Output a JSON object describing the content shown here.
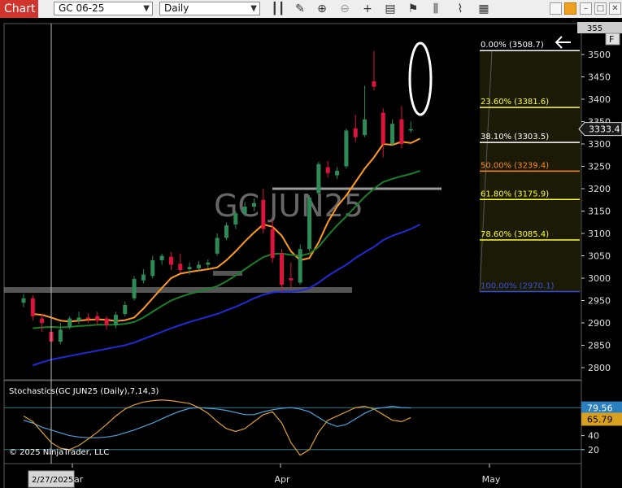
{
  "toolbar": {
    "tab_label": "Chart",
    "instrument": "GC 06-25",
    "interval": "Daily",
    "icons": [
      "bar-type-icon",
      "draw-pencil-icon",
      "zoom-in-icon",
      "zoom-out-icon",
      "crosshair-icon",
      "data-box-icon",
      "strategies-icon",
      "indicators-icon",
      "templates-icon",
      "properties-icon"
    ]
  },
  "chart": {
    "watermark": "GC JUN25",
    "copyright": "© 2025 NinjaTrader, LLC",
    "stoch_label": "Stochastics(GC JUN25 (Daily),7,14,3)",
    "current_price": "3333.4",
    "top_price": "355",
    "f_label": "F",
    "cursor_date": "2/27/2025",
    "x_labels": [
      {
        "text": "ar",
        "x": 91
      },
      {
        "text": "Apr",
        "x": 347
      },
      {
        "text": "May",
        "x": 604
      }
    ],
    "price_ticks": [
      2800,
      2850,
      2900,
      2950,
      3000,
      3050,
      3100,
      3150,
      3200,
      3250,
      3300,
      3350,
      3400,
      3450,
      3500
    ],
    "stoch_ticks": [
      20,
      40
    ],
    "stoch_values": {
      "k": "79.56",
      "d": "65.79"
    },
    "fib_levels": [
      {
        "label": "0.00% (3508.7)",
        "price": 3508.7,
        "color": "#ffffff"
      },
      {
        "label": "23.60% (3381.6)",
        "price": 3381.6,
        "color": "#ffff33"
      },
      {
        "label": "38.10% (3303.5)",
        "price": 3303.5,
        "color": "#ffffff"
      },
      {
        "label": "50.00% (3239.4)",
        "price": 3239.4,
        "color": "#ff8c1a"
      },
      {
        "label": "61.80% (3175.9)",
        "price": 3175.9,
        "color": "#ffff33"
      },
      {
        "label": "78.60% (3085.4)",
        "price": 3085.4,
        "color": "#ffff33"
      },
      {
        "label": "100.00% (2970.1)",
        "price": 2970.1,
        "color": "#3a4fd6"
      }
    ],
    "colors": {
      "up": "#2e8b57",
      "down": "#dc143c",
      "ema_fast": "#ff9a1f",
      "ema_mid": "#1a7f2a",
      "ema_slow": "#1f2bd6",
      "stoch_k": "#4aa3df",
      "stoch_d": "#e0a030"
    }
  },
  "chart_data": {
    "type": "candlestick",
    "title": "",
    "candles": [
      {
        "o": 2945,
        "h": 2965,
        "l": 2935,
        "c": 2955
      },
      {
        "o": 2955,
        "h": 2962,
        "l": 2905,
        "c": 2915
      },
      {
        "o": 2910,
        "h": 2920,
        "l": 2880,
        "c": 2900
      },
      {
        "o": 2880,
        "h": 2890,
        "l": 2848,
        "c": 2858
      },
      {
        "o": 2858,
        "h": 2900,
        "l": 2852,
        "c": 2885
      },
      {
        "o": 2892,
        "h": 2915,
        "l": 2886,
        "c": 2910
      },
      {
        "o": 2905,
        "h": 2925,
        "l": 2898,
        "c": 2912
      },
      {
        "o": 2912,
        "h": 2922,
        "l": 2900,
        "c": 2908
      },
      {
        "o": 2915,
        "h": 2925,
        "l": 2895,
        "c": 2905
      },
      {
        "o": 2910,
        "h": 2915,
        "l": 2885,
        "c": 2895
      },
      {
        "o": 2895,
        "h": 2925,
        "l": 2888,
        "c": 2918
      },
      {
        "o": 2920,
        "h": 2948,
        "l": 2915,
        "c": 2940
      },
      {
        "o": 2955,
        "h": 3005,
        "l": 2950,
        "c": 2998
      },
      {
        "o": 2995,
        "h": 3020,
        "l": 2988,
        "c": 3008
      },
      {
        "o": 3005,
        "h": 3050,
        "l": 3000,
        "c": 3040
      },
      {
        "o": 3040,
        "h": 3055,
        "l": 3030,
        "c": 3050
      },
      {
        "o": 3048,
        "h": 3058,
        "l": 3018,
        "c": 3030
      },
      {
        "o": 3032,
        "h": 3055,
        "l": 3012,
        "c": 3018
      },
      {
        "o": 3020,
        "h": 3035,
        "l": 3008,
        "c": 3025
      },
      {
        "o": 3022,
        "h": 3038,
        "l": 3015,
        "c": 3030
      },
      {
        "o": 3030,
        "h": 3042,
        "l": 3022,
        "c": 3035
      },
      {
        "o": 3055,
        "h": 3100,
        "l": 3050,
        "c": 3090
      },
      {
        "o": 3090,
        "h": 3125,
        "l": 3085,
        "c": 3118
      },
      {
        "o": 3120,
        "h": 3150,
        "l": 3110,
        "c": 3145
      },
      {
        "o": 3145,
        "h": 3170,
        "l": 3138,
        "c": 3160
      },
      {
        "o": 3160,
        "h": 3178,
        "l": 3150,
        "c": 3168
      },
      {
        "o": 3175,
        "h": 3200,
        "l": 3100,
        "c": 3110
      },
      {
        "o": 3110,
        "h": 3130,
        "l": 3035,
        "c": 3045
      },
      {
        "o": 3055,
        "h": 3065,
        "l": 2970,
        "c": 2985
      },
      {
        "o": 3000,
        "h": 3035,
        "l": 2978,
        "c": 2995
      },
      {
        "o": 2990,
        "h": 3075,
        "l": 2985,
        "c": 3065
      },
      {
        "o": 3065,
        "h": 3185,
        "l": 3060,
        "c": 3180
      },
      {
        "o": 3190,
        "h": 3260,
        "l": 3185,
        "c": 3255
      },
      {
        "o": 3248,
        "h": 3262,
        "l": 3225,
        "c": 3235
      },
      {
        "o": 3230,
        "h": 3248,
        "l": 3222,
        "c": 3240
      },
      {
        "o": 3250,
        "h": 3335,
        "l": 3245,
        "c": 3330
      },
      {
        "o": 3335,
        "h": 3365,
        "l": 3305,
        "c": 3315
      },
      {
        "o": 3320,
        "h": 3430,
        "l": 3315,
        "c": 3355
      },
      {
        "o": 3440,
        "h": 3508,
        "l": 3420,
        "c": 3428
      },
      {
        "o": 3370,
        "h": 3380,
        "l": 3270,
        "c": 3300
      },
      {
        "o": 3300,
        "h": 3355,
        "l": 3295,
        "c": 3345
      },
      {
        "o": 3355,
        "h": 3385,
        "l": 3290,
        "c": 3300
      },
      {
        "o": 3330,
        "h": 3350,
        "l": 3325,
        "c": 3333
      }
    ],
    "ema_fast": [
      2920,
      2918,
      2912,
      2905,
      2903,
      2905,
      2907,
      2908,
      2907,
      2904,
      2906,
      2912,
      2932,
      2955,
      2978,
      3000,
      3010,
      3014,
      3017,
      3020,
      3024,
      3040,
      3060,
      3082,
      3102,
      3120,
      3115,
      3095,
      3060,
      3040,
      3045,
      3080,
      3125,
      3160,
      3185,
      3215,
      3245,
      3270,
      3300,
      3298,
      3305,
      3302,
      3312
    ],
    "ema_mid": [
      2888,
      2890,
      2891,
      2890,
      2891,
      2893,
      2894,
      2896,
      2896,
      2896,
      2898,
      2902,
      2912,
      2925,
      2938,
      2950,
      2958,
      2965,
      2970,
      2976,
      2982,
      2993,
      3006,
      3020,
      3034,
      3047,
      3054,
      3055,
      3052,
      3050,
      3055,
      3070,
      3095,
      3118,
      3138,
      3160,
      3182,
      3200,
      3215,
      3222,
      3228,
      3233,
      3240
    ],
    "ema_slow": [
      2805,
      2812,
      2818,
      2822,
      2826,
      2830,
      2834,
      2838,
      2842,
      2846,
      2850,
      2856,
      2864,
      2872,
      2880,
      2888,
      2895,
      2902,
      2908,
      2914,
      2920,
      2928,
      2936,
      2945,
      2955,
      2963,
      2968,
      2970,
      2970,
      2972,
      2978,
      2990,
      3005,
      3018,
      3030,
      3045,
      3058,
      3070,
      3085,
      3095,
      3102,
      3110,
      3120
    ],
    "stoch_k": [
      62,
      58,
      52,
      48,
      44,
      40,
      38,
      37,
      37,
      38,
      40,
      44,
      48,
      53,
      58,
      64,
      70,
      75,
      79,
      80,
      79,
      78,
      76,
      73,
      70,
      70,
      74,
      77,
      79,
      80,
      78,
      74,
      66,
      58,
      53,
      56,
      64,
      72,
      78,
      80,
      82,
      80,
      79.56
    ],
    "stoch_d": [
      68,
      60,
      45,
      30,
      22,
      20,
      26,
      35,
      45,
      56,
      68,
      78,
      84,
      88,
      90,
      91,
      90,
      88,
      86,
      80,
      72,
      60,
      50,
      46,
      50,
      60,
      70,
      74,
      58,
      30,
      12,
      20,
      45,
      62,
      68,
      74,
      80,
      82,
      78,
      70,
      62,
      60,
      65.79
    ],
    "ylim": [
      2780,
      3560
    ]
  }
}
